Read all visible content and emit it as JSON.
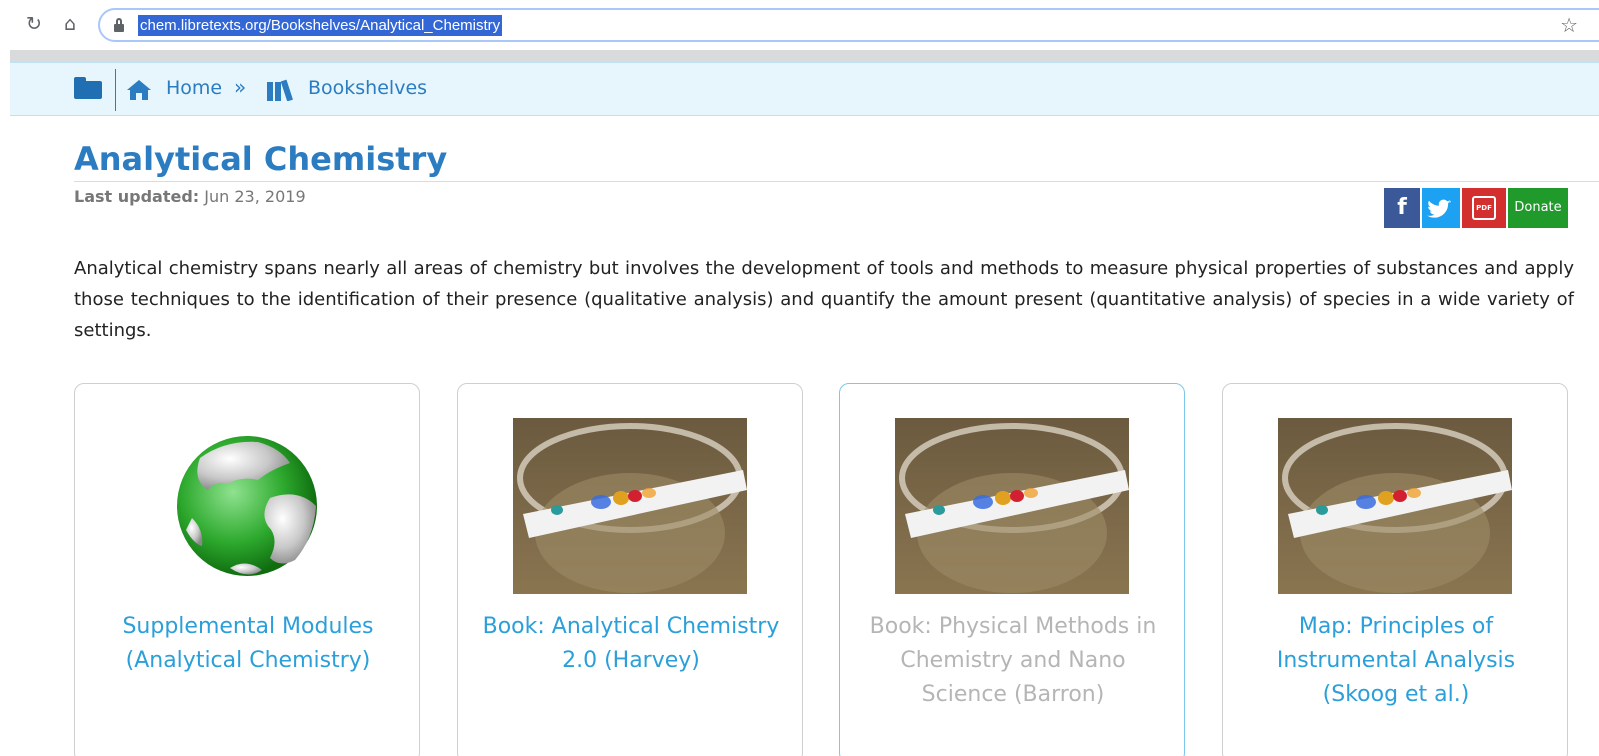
{
  "browser": {
    "url": "chem.libretexts.org/Bookshelves/Analytical_Chemistry",
    "reload_icon": "reload-icon",
    "home_icon": "home-icon",
    "star_icon": "star-icon"
  },
  "breadcrumb": {
    "home_label": "Home",
    "separator": "»",
    "bookshelves_label": "Bookshelves"
  },
  "page": {
    "title": "Analytical Chemistry",
    "updated_label": "Last updated:",
    "updated_date": "Jun 23, 2019",
    "intro": "Analytical chemistry spans nearly all areas of chemistry but involves the development of tools and methods to measure physical properties of substances and apply those techniques to the identification of their presence (qualitative analysis) and quantify the amount present (quantitative analysis) of species in a wide variety of settings."
  },
  "share": {
    "facebook": "f",
    "pdf": "PDF",
    "donate": "Donate"
  },
  "cards": [
    {
      "label": "Supplemental Modules (Analytical Chemistry)"
    },
    {
      "label": "Book: Analytical Chemistry 2.0 (Harvey)"
    },
    {
      "label": "Book: Physical Methods in Chemistry and Nano Science (Barron)"
    },
    {
      "label": "Map: Principles of Instrumental Analysis (Skoog et al.)"
    }
  ],
  "colors": {
    "link": "#2b7cc0",
    "card_link": "#2b9fd9",
    "facebook": "#3b5998",
    "twitter": "#1da1f2",
    "pdf": "#d32f2f",
    "donate": "#1f9a2b"
  }
}
